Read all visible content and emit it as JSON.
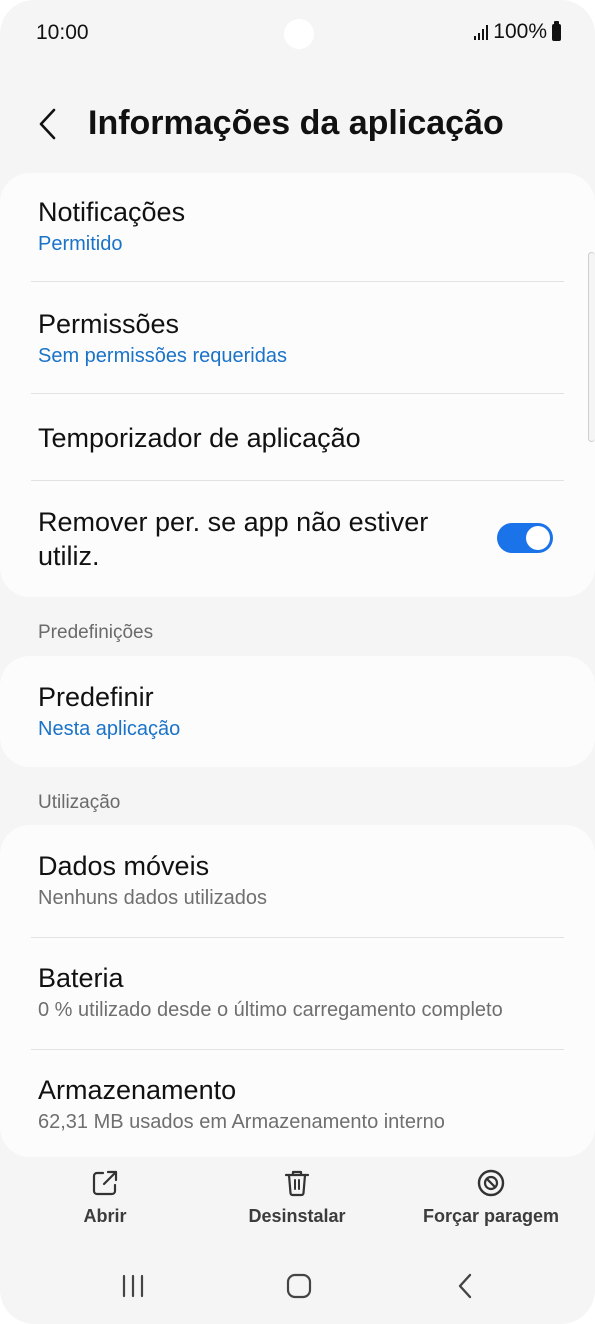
{
  "status_bar": {
    "time": "10:00",
    "battery": "100%"
  },
  "header": {
    "title": "Informações da aplicação",
    "back_icon": "chevron-left-icon"
  },
  "settings_card": {
    "items": [
      {
        "title": "Notificações",
        "subtitle": "Permitido"
      },
      {
        "title": "Permissões",
        "subtitle": "Sem permissões requeridas"
      },
      {
        "title": "Temporizador de aplicação"
      },
      {
        "title_line1": "Remover per. se app não estiver",
        "title_line2": "utiliz.",
        "toggle_on": true
      }
    ]
  },
  "defaults_section": {
    "label": "Predefinições",
    "item": {
      "title": "Predefinir",
      "subtitle": "Nesta aplicação"
    }
  },
  "usage_section": {
    "label": "Utilização",
    "items": [
      {
        "title": "Dados móveis",
        "subtitle": "Nenhuns dados utilizados"
      },
      {
        "title": "Bateria",
        "subtitle": "0 % utilizado desde o último carregamento completo"
      },
      {
        "title": "Armazenamento",
        "subtitle": "62,31 MB usados em Armazenamento interno"
      }
    ]
  },
  "actions": {
    "open": {
      "label": "Abrir",
      "icon": "open-external-icon"
    },
    "uninstall": {
      "label": "Desinstalar",
      "icon": "trash-icon"
    },
    "force_stop": {
      "label": "Forçar paragem",
      "icon": "block-icon"
    }
  },
  "colors": {
    "accent": "#1a73e8",
    "link_blue": "#1a73c9",
    "background": "#f5f5f5",
    "card": "#fcfcfc"
  }
}
